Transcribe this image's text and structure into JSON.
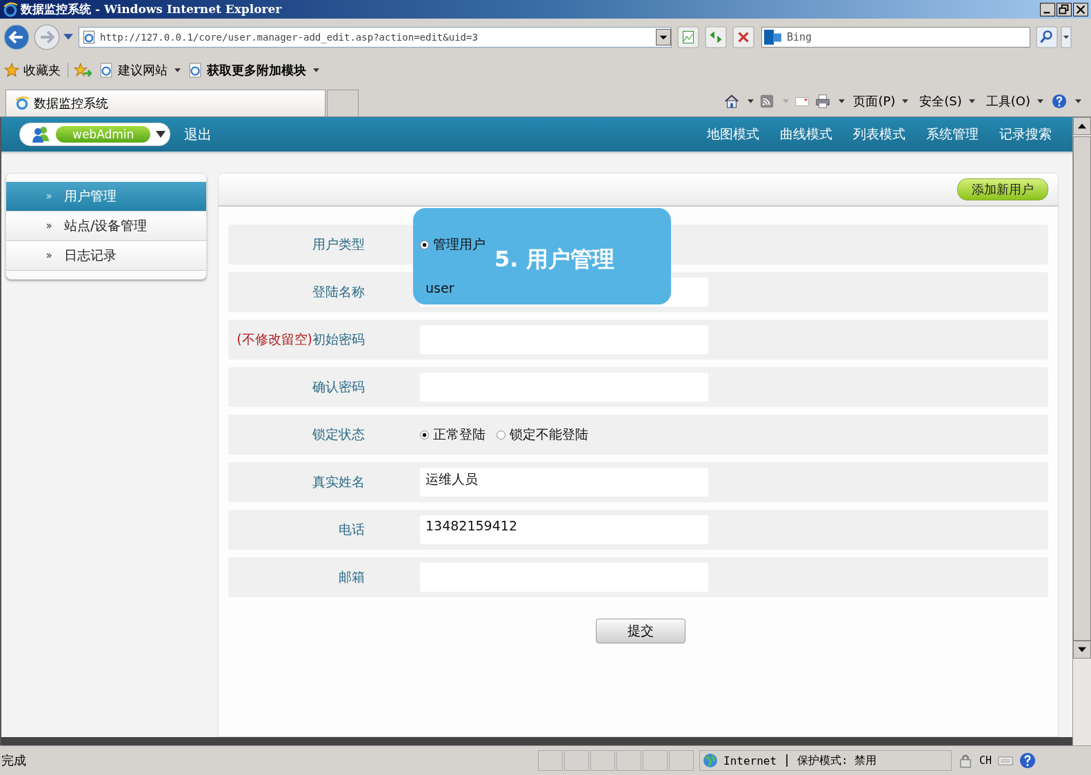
{
  "window": {
    "title": "数据监控系统 - Windows Internet Explorer"
  },
  "address_bar": {
    "url": "http://127.0.0.1/core/user.manager-add_edit.asp?action=edit&uid=3"
  },
  "search": {
    "placeholder": "Bing"
  },
  "favorites_bar": {
    "favorites": "收藏夹",
    "links": [
      {
        "label": "建议网站",
        "bold": false
      },
      {
        "label": "获取更多附加模块",
        "bold": true
      }
    ]
  },
  "tab": {
    "title": "数据监控系统"
  },
  "command_bar": [
    "页面(P)",
    "安全(S)",
    "工具(O)"
  ],
  "app_header": {
    "user": "webAdmin",
    "logout": "退出",
    "nav": [
      "地图模式",
      "曲线模式",
      "列表模式",
      "系统管理",
      "记录搜索"
    ]
  },
  "sidebar": {
    "items": [
      {
        "label": "用户管理",
        "selected": true
      },
      {
        "label": "站点/设备管理",
        "selected": false
      },
      {
        "label": "日志记录",
        "selected": false
      }
    ]
  },
  "toolbar": {
    "add_button": "添加新用户"
  },
  "form": {
    "rows": [
      {
        "kind": "radio",
        "label": "用户类型",
        "options": [
          {
            "label": "管理用户",
            "selected": true
          }
        ]
      },
      {
        "kind": "text",
        "label": "登陆名称",
        "value": "user"
      },
      {
        "kind": "text",
        "label": "初始密码",
        "note": "(不修改留空)"
      },
      {
        "kind": "text",
        "label": "确认密码"
      },
      {
        "kind": "radio",
        "label": "锁定状态",
        "options": [
          {
            "label": "正常登陆",
            "selected": true
          },
          {
            "label": "锁定不能登陆",
            "selected": false
          }
        ]
      },
      {
        "kind": "text",
        "label": "真实姓名",
        "value": "运维人员"
      },
      {
        "kind": "text",
        "label": "电话",
        "value": "13482159412"
      },
      {
        "kind": "text",
        "label": "邮箱"
      }
    ],
    "submit": "提交"
  },
  "overlay_caption": "5. 用户管理",
  "status_bar": {
    "status": "完成",
    "zone": "Internet",
    "protected_mode": "保护模式: 禁用",
    "language": "CH"
  }
}
